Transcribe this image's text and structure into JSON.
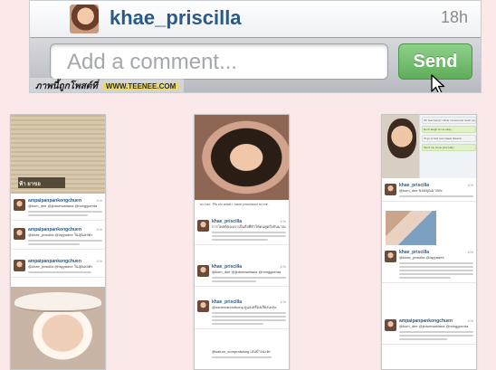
{
  "banner": {
    "username": "khae_priscilla",
    "time": "18h",
    "comment_placeholder": "Add a comment...",
    "send_label": "Send",
    "watermark_thai": "ภาพนี้ถูกโพสต์ที่",
    "watermark_site": "WWW.TEENEE.COM"
  },
  "shot1": {
    "photo_caption": "ฟ้า ยาขอ",
    "comments": [
      {
        "user": "ampaipanpankongchuen",
        "time": "10h",
        "text": "@kom_dee @jintumwattana @minggcenta"
      },
      {
        "user": "ampaipanpankongchuen",
        "time": "10h",
        "text": "@khae_priscilla @fayyadee ในสุดเลยค่ะ"
      },
      {
        "user": "ampaipanpankongchuen",
        "time": "10h",
        "text": "@khae_priscilla @fayyadee ในสุดเลยค่ะ"
      }
    ]
  },
  "shot2": {
    "top_text": "no bro. Pls do what I have promised to me.",
    "comments": [
      {
        "user": "khae_priscilla",
        "time": "10h",
        "text": "การโพสต์ของเราเป็นสิ่งที่ทำให้คนพูดถึงกันมากมาย"
      },
      {
        "user": "khae_priscilla",
        "time": "10h",
        "text": "@kom_dee @jintumwattana @minggcenta"
      },
      {
        "user": "khae_priscilla",
        "time": "10h",
        "text": "@narmwandotkong ดูแลเครื่องเสียงนะคะ"
      },
      {
        "user": "",
        "time": "",
        "text": "@saturn_sompraiwang เล่นบ้างนะคะ"
      }
    ]
  },
  "shot3": {
    "chat_lines": [
      "Oh how funny! I think I know how much you love them.",
      "Don't laugh at me okay.",
      "I'll go to bed now sweet dreams",
      "Send me some pics baby"
    ],
    "comments": [
      {
        "user": "khae_priscilla",
        "time": "10h",
        "text": "@kom_dee ขอบคุณมากค่ะ"
      },
      {
        "user": "khae_priscilla",
        "time": "10h",
        "text": "@khae_priscilla @fayyadee"
      },
      {
        "user": "ampaipanpankongchuen",
        "time": "10h",
        "text": "@kom_dee @jintumwattana @minggcenta"
      }
    ]
  }
}
